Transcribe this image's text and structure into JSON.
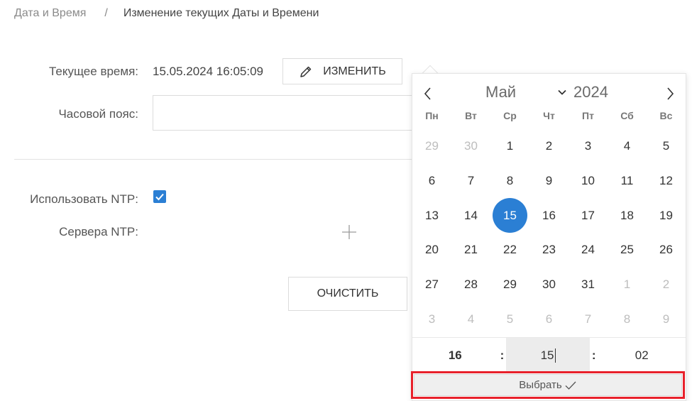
{
  "breadcrumb": {
    "parent": "Дата и Время",
    "separator": "/",
    "current": "Изменение текущих Даты и Времени"
  },
  "form": {
    "current_time_label": "Текущее время:",
    "current_time_value": "15.05.2024 16:05:09",
    "change_button": "ИЗМЕНИТЬ",
    "timezone_label": "Часовой пояс:",
    "timezone_value": "",
    "use_ntp_label": "Использовать NTP:",
    "use_ntp_checked": true,
    "ntp_servers_label": "Сервера NTP:",
    "clear_button": "ОЧИСТИТЬ"
  },
  "calendar": {
    "month": "Май",
    "year": "2024",
    "weekdays": [
      "Пн",
      "Вт",
      "Ср",
      "Чт",
      "Пт",
      "Сб",
      "Вс"
    ],
    "weeks": [
      [
        {
          "d": "29",
          "m": true
        },
        {
          "d": "30",
          "m": true
        },
        {
          "d": "1"
        },
        {
          "d": "2"
        },
        {
          "d": "3"
        },
        {
          "d": "4"
        },
        {
          "d": "5"
        }
      ],
      [
        {
          "d": "6"
        },
        {
          "d": "7"
        },
        {
          "d": "8"
        },
        {
          "d": "9"
        },
        {
          "d": "10"
        },
        {
          "d": "11"
        },
        {
          "d": "12"
        }
      ],
      [
        {
          "d": "13"
        },
        {
          "d": "14"
        },
        {
          "d": "15",
          "s": true
        },
        {
          "d": "16"
        },
        {
          "d": "17"
        },
        {
          "d": "18"
        },
        {
          "d": "19"
        }
      ],
      [
        {
          "d": "20"
        },
        {
          "d": "21"
        },
        {
          "d": "22"
        },
        {
          "d": "23"
        },
        {
          "d": "24"
        },
        {
          "d": "25"
        },
        {
          "d": "26"
        }
      ],
      [
        {
          "d": "27"
        },
        {
          "d": "28"
        },
        {
          "d": "29"
        },
        {
          "d": "30"
        },
        {
          "d": "31"
        },
        {
          "d": "1",
          "m": true
        },
        {
          "d": "2",
          "m": true
        }
      ],
      [
        {
          "d": "3",
          "m": true
        },
        {
          "d": "4",
          "m": true
        },
        {
          "d": "5",
          "m": true
        },
        {
          "d": "6",
          "m": true
        },
        {
          "d": "7",
          "m": true
        },
        {
          "d": "8",
          "m": true
        },
        {
          "d": "9",
          "m": true
        }
      ]
    ],
    "time": {
      "hours": "16",
      "separator": ":",
      "minutes": "15",
      "seconds": "02"
    },
    "select_button": "Выбрать"
  },
  "colors": {
    "accent": "#2b7fd4",
    "highlight": "#e8212b"
  },
  "icons": {
    "change": "pencil-icon",
    "checkbox": "checkmark-icon",
    "add_server": "plus-icon",
    "prev_month": "chevron-left-icon",
    "next_month": "chevron-right-icon",
    "month_dropdown": "chevron-down-icon",
    "confirm": "checkmark-icon"
  }
}
